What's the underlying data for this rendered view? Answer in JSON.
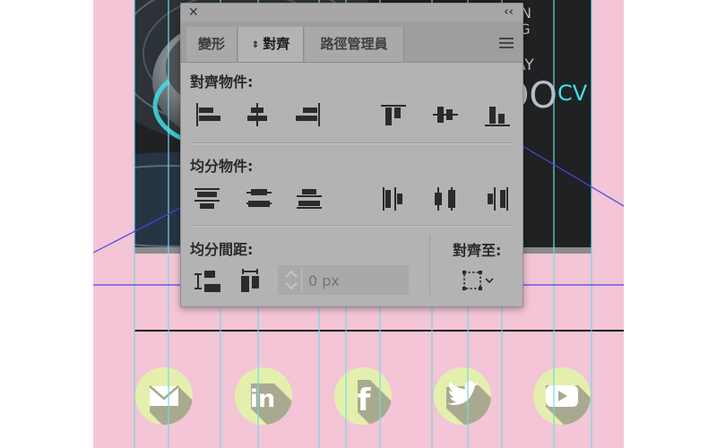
{
  "colors": {
    "artboard": "#f3c5d6",
    "guide_cyan": "#72dbe4",
    "guide_blue": "#4646e6",
    "panel_bg": "#b3b3b3",
    "social_circle": "#e5efad",
    "social_shadow": "#a9a98f",
    "photo_glow": "#3fe0e6"
  },
  "background": {
    "photo_text_lines": [
      "ERIEN",
      "DESIG",
      "F LAY",
      "LOO",
      "CV"
    ]
  },
  "social_icons": [
    {
      "name": "mail-icon"
    },
    {
      "name": "linkedin-icon",
      "glyph": "in"
    },
    {
      "name": "facebook-icon",
      "glyph": "f"
    },
    {
      "name": "twitter-icon"
    },
    {
      "name": "youtube-icon"
    }
  ],
  "panel": {
    "tabs": [
      "變形",
      "對齊",
      "路徑管理員"
    ],
    "active_tab": "對齊",
    "align_objects": {
      "title": "對齊物件:",
      "buttons": [
        "horizontal-align-left-icon",
        "horizontal-align-center-icon",
        "horizontal-align-right-icon",
        "vertical-align-top-icon",
        "vertical-align-center-icon",
        "vertical-align-bottom-icon"
      ]
    },
    "distribute_objects": {
      "title": "均分物件:",
      "buttons": [
        "vertical-distribute-top-icon",
        "vertical-distribute-center-icon",
        "vertical-distribute-bottom-icon",
        "horizontal-distribute-left-icon",
        "horizontal-distribute-center-icon",
        "horizontal-distribute-right-icon"
      ]
    },
    "distribute_spacing": {
      "title": "均分間距:",
      "buttons": [
        "vertical-distribute-space-icon",
        "horizontal-distribute-space-icon"
      ],
      "spacing_value": "",
      "spacing_placeholder": "0 px"
    },
    "align_to": {
      "title": "對齊至:",
      "icon": "align-to-selection-icon"
    }
  }
}
